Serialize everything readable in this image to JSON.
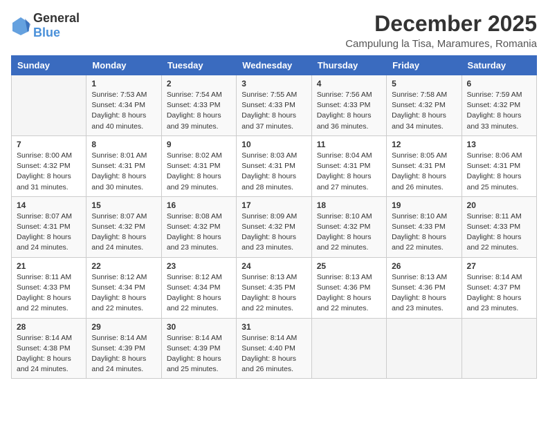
{
  "logo": {
    "general": "General",
    "blue": "Blue"
  },
  "title": "December 2025",
  "location": "Campulung la Tisa, Maramures, Romania",
  "weekdays": [
    "Sunday",
    "Monday",
    "Tuesday",
    "Wednesday",
    "Thursday",
    "Friday",
    "Saturday"
  ],
  "weeks": [
    [
      {
        "day": "",
        "info": ""
      },
      {
        "day": "1",
        "info": "Sunrise: 7:53 AM\nSunset: 4:34 PM\nDaylight: 8 hours\nand 40 minutes."
      },
      {
        "day": "2",
        "info": "Sunrise: 7:54 AM\nSunset: 4:33 PM\nDaylight: 8 hours\nand 39 minutes."
      },
      {
        "day": "3",
        "info": "Sunrise: 7:55 AM\nSunset: 4:33 PM\nDaylight: 8 hours\nand 37 minutes."
      },
      {
        "day": "4",
        "info": "Sunrise: 7:56 AM\nSunset: 4:33 PM\nDaylight: 8 hours\nand 36 minutes."
      },
      {
        "day": "5",
        "info": "Sunrise: 7:58 AM\nSunset: 4:32 PM\nDaylight: 8 hours\nand 34 minutes."
      },
      {
        "day": "6",
        "info": "Sunrise: 7:59 AM\nSunset: 4:32 PM\nDaylight: 8 hours\nand 33 minutes."
      }
    ],
    [
      {
        "day": "7",
        "info": "Sunrise: 8:00 AM\nSunset: 4:32 PM\nDaylight: 8 hours\nand 31 minutes."
      },
      {
        "day": "8",
        "info": "Sunrise: 8:01 AM\nSunset: 4:31 PM\nDaylight: 8 hours\nand 30 minutes."
      },
      {
        "day": "9",
        "info": "Sunrise: 8:02 AM\nSunset: 4:31 PM\nDaylight: 8 hours\nand 29 minutes."
      },
      {
        "day": "10",
        "info": "Sunrise: 8:03 AM\nSunset: 4:31 PM\nDaylight: 8 hours\nand 28 minutes."
      },
      {
        "day": "11",
        "info": "Sunrise: 8:04 AM\nSunset: 4:31 PM\nDaylight: 8 hours\nand 27 minutes."
      },
      {
        "day": "12",
        "info": "Sunrise: 8:05 AM\nSunset: 4:31 PM\nDaylight: 8 hours\nand 26 minutes."
      },
      {
        "day": "13",
        "info": "Sunrise: 8:06 AM\nSunset: 4:31 PM\nDaylight: 8 hours\nand 25 minutes."
      }
    ],
    [
      {
        "day": "14",
        "info": "Sunrise: 8:07 AM\nSunset: 4:31 PM\nDaylight: 8 hours\nand 24 minutes."
      },
      {
        "day": "15",
        "info": "Sunrise: 8:07 AM\nSunset: 4:32 PM\nDaylight: 8 hours\nand 24 minutes."
      },
      {
        "day": "16",
        "info": "Sunrise: 8:08 AM\nSunset: 4:32 PM\nDaylight: 8 hours\nand 23 minutes."
      },
      {
        "day": "17",
        "info": "Sunrise: 8:09 AM\nSunset: 4:32 PM\nDaylight: 8 hours\nand 23 minutes."
      },
      {
        "day": "18",
        "info": "Sunrise: 8:10 AM\nSunset: 4:32 PM\nDaylight: 8 hours\nand 22 minutes."
      },
      {
        "day": "19",
        "info": "Sunrise: 8:10 AM\nSunset: 4:33 PM\nDaylight: 8 hours\nand 22 minutes."
      },
      {
        "day": "20",
        "info": "Sunrise: 8:11 AM\nSunset: 4:33 PM\nDaylight: 8 hours\nand 22 minutes."
      }
    ],
    [
      {
        "day": "21",
        "info": "Sunrise: 8:11 AM\nSunset: 4:33 PM\nDaylight: 8 hours\nand 22 minutes."
      },
      {
        "day": "22",
        "info": "Sunrise: 8:12 AM\nSunset: 4:34 PM\nDaylight: 8 hours\nand 22 minutes."
      },
      {
        "day": "23",
        "info": "Sunrise: 8:12 AM\nSunset: 4:34 PM\nDaylight: 8 hours\nand 22 minutes."
      },
      {
        "day": "24",
        "info": "Sunrise: 8:13 AM\nSunset: 4:35 PM\nDaylight: 8 hours\nand 22 minutes."
      },
      {
        "day": "25",
        "info": "Sunrise: 8:13 AM\nSunset: 4:36 PM\nDaylight: 8 hours\nand 22 minutes."
      },
      {
        "day": "26",
        "info": "Sunrise: 8:13 AM\nSunset: 4:36 PM\nDaylight: 8 hours\nand 23 minutes."
      },
      {
        "day": "27",
        "info": "Sunrise: 8:14 AM\nSunset: 4:37 PM\nDaylight: 8 hours\nand 23 minutes."
      }
    ],
    [
      {
        "day": "28",
        "info": "Sunrise: 8:14 AM\nSunset: 4:38 PM\nDaylight: 8 hours\nand 24 minutes."
      },
      {
        "day": "29",
        "info": "Sunrise: 8:14 AM\nSunset: 4:39 PM\nDaylight: 8 hours\nand 24 minutes."
      },
      {
        "day": "30",
        "info": "Sunrise: 8:14 AM\nSunset: 4:39 PM\nDaylight: 8 hours\nand 25 minutes."
      },
      {
        "day": "31",
        "info": "Sunrise: 8:14 AM\nSunset: 4:40 PM\nDaylight: 8 hours\nand 26 minutes."
      },
      {
        "day": "",
        "info": ""
      },
      {
        "day": "",
        "info": ""
      },
      {
        "day": "",
        "info": ""
      }
    ]
  ]
}
